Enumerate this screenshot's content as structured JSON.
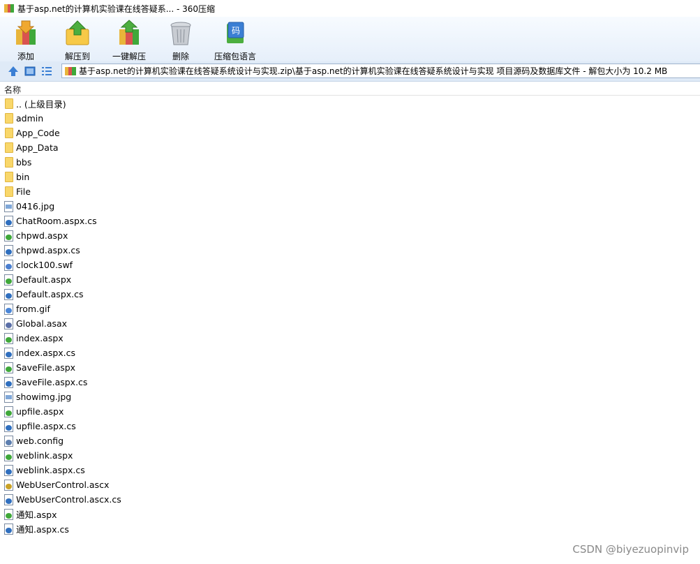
{
  "window": {
    "title": "基于asp.net的计算机实验课在线答疑系... - 360压缩"
  },
  "toolbar": {
    "buttons": [
      {
        "label": "添加",
        "icon": "add-archive-icon"
      },
      {
        "label": "解压到",
        "icon": "extract-to-icon"
      },
      {
        "label": "一键解压",
        "icon": "one-click-extract-icon"
      },
      {
        "label": "删除",
        "icon": "delete-trash-icon"
      },
      {
        "label": "压缩包语言",
        "icon": "archive-language-icon"
      }
    ]
  },
  "address": {
    "path": "基于asp.net的计算机实验课在线答疑系统设计与实现.zip\\基于asp.net的计算机实验课在线答疑系统设计与实现 项目源码及数据库文件 - 解包大小为 10.2 MB"
  },
  "list": {
    "column_name": "名称",
    "items": [
      {
        "name": ".. (上级目录)",
        "type": "folder"
      },
      {
        "name": "admin",
        "type": "folder"
      },
      {
        "name": "App_Code",
        "type": "folder"
      },
      {
        "name": "App_Data",
        "type": "folder"
      },
      {
        "name": "bbs",
        "type": "folder"
      },
      {
        "name": "bin",
        "type": "folder"
      },
      {
        "name": "File",
        "type": "folder"
      },
      {
        "name": "0416.jpg",
        "type": "image"
      },
      {
        "name": "ChatRoom.aspx.cs",
        "type": "cs"
      },
      {
        "name": "chpwd.aspx",
        "type": "aspx"
      },
      {
        "name": "chpwd.aspx.cs",
        "type": "cs"
      },
      {
        "name": "clock100.swf",
        "type": "swf"
      },
      {
        "name": "Default.aspx",
        "type": "aspx"
      },
      {
        "name": "Default.aspx.cs",
        "type": "cs"
      },
      {
        "name": "from.gif",
        "type": "gif"
      },
      {
        "name": "Global.asax",
        "type": "asax"
      },
      {
        "name": "index.aspx",
        "type": "aspx"
      },
      {
        "name": "index.aspx.cs",
        "type": "cs"
      },
      {
        "name": "SaveFile.aspx",
        "type": "aspx"
      },
      {
        "name": "SaveFile.aspx.cs",
        "type": "cs"
      },
      {
        "name": "showimg.jpg",
        "type": "image"
      },
      {
        "name": "upfile.aspx",
        "type": "aspx"
      },
      {
        "name": "upfile.aspx.cs",
        "type": "cs"
      },
      {
        "name": "web.config",
        "type": "config"
      },
      {
        "name": "weblink.aspx",
        "type": "aspx"
      },
      {
        "name": "weblink.aspx.cs",
        "type": "cs"
      },
      {
        "name": "WebUserControl.ascx",
        "type": "ascx"
      },
      {
        "name": "WebUserControl.ascx.cs",
        "type": "cs"
      },
      {
        "name": "通知.aspx",
        "type": "aspx"
      },
      {
        "name": "通知.aspx.cs",
        "type": "cs"
      }
    ]
  },
  "watermark": "CSDN @biyezuopinvip",
  "colors": {
    "toolbar_bg": "#e6effa",
    "folder": "#f9d76a",
    "aspx_badge": "#3fa83a",
    "cs_badge": "#2f6fbf"
  }
}
